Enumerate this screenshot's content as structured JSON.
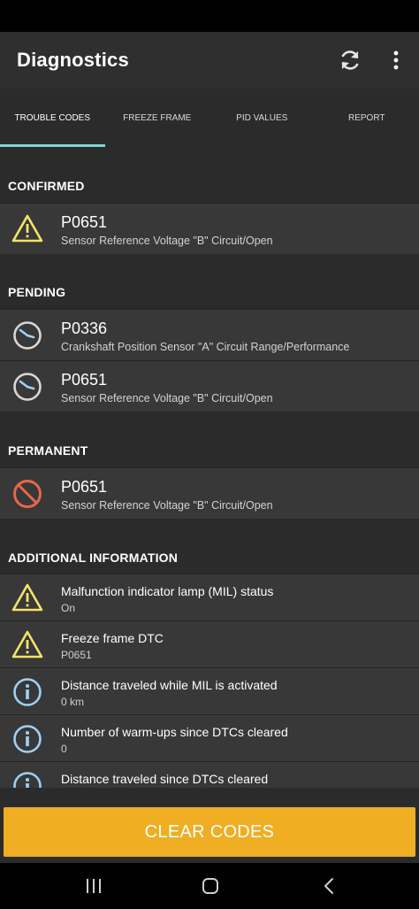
{
  "app_bar": {
    "title": "Diagnostics",
    "refresh_icon": "refresh-icon",
    "menu_icon": "more-vert-icon"
  },
  "tabs": [
    {
      "label": "TROUBLE CODES",
      "active": true
    },
    {
      "label": "FREEZE FRAME",
      "active": false
    },
    {
      "label": "PID VALUES",
      "active": false
    },
    {
      "label": "REPORT",
      "active": false
    }
  ],
  "sections": {
    "confirmed": {
      "title": "CONFIRMED",
      "items": [
        {
          "code": "P0651",
          "description": "Sensor Reference Voltage \"B\" Circuit/Open",
          "icon": "warning-icon"
        }
      ]
    },
    "pending": {
      "title": "PENDING",
      "items": [
        {
          "code": "P0336",
          "description": "Crankshaft Position Sensor \"A\" Circuit Range/Performance",
          "icon": "clock-icon"
        },
        {
          "code": "P0651",
          "description": "Sensor Reference Voltage \"B\" Circuit/Open",
          "icon": "clock-icon"
        }
      ]
    },
    "permanent": {
      "title": "PERMANENT",
      "items": [
        {
          "code": "P0651",
          "description": "Sensor Reference Voltage \"B\" Circuit/Open",
          "icon": "prohibited-icon"
        }
      ]
    },
    "additional": {
      "title": "ADDITIONAL INFORMATION",
      "items": [
        {
          "title": "Malfunction indicator lamp (MIL) status",
          "value": "On",
          "icon": "warning-icon"
        },
        {
          "title": "Freeze frame DTC",
          "value": "P0651",
          "icon": "warning-icon"
        },
        {
          "title": "Distance traveled while MIL is activated",
          "value": "0 km",
          "icon": "info-icon"
        },
        {
          "title": "Number of warm-ups since DTCs cleared",
          "value": "0",
          "icon": "info-icon"
        },
        {
          "title": "Distance traveled since DTCs cleared",
          "value": "",
          "icon": "info-icon"
        }
      ]
    }
  },
  "clear_button": {
    "label": "CLEAR CODES"
  },
  "colors": {
    "accent": "#f0ae22",
    "tab_indicator": "#7fd3cf",
    "warning": "#f3e36c",
    "info": "#9fd0f5",
    "prohibited": "#e7674a"
  },
  "nav": {
    "recents_icon": "recents-icon",
    "home_icon": "home-icon",
    "back_icon": "back-icon"
  }
}
